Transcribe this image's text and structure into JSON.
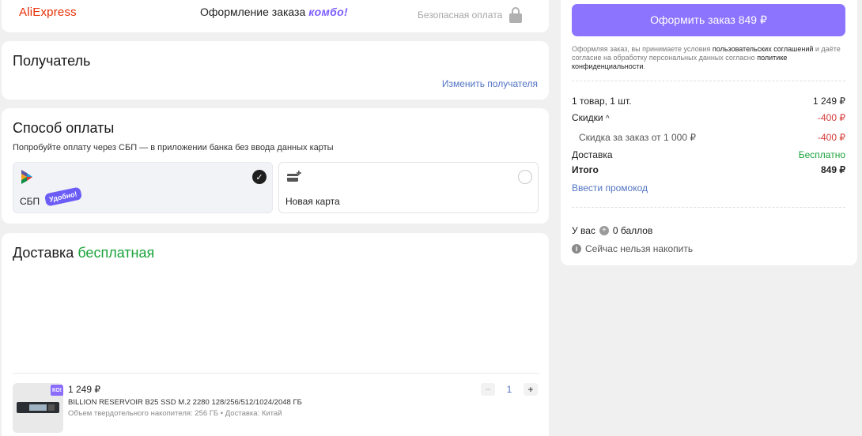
{
  "header": {
    "logo": "AliExpress",
    "title": "Оформление заказа",
    "combo": "комбо!",
    "secure": "Безопасная оплата"
  },
  "recipient": {
    "title": "Получатель",
    "change_link": "Изменить получателя"
  },
  "payment": {
    "title": "Способ оплаты",
    "hint": "Попробуйте оплату через СБП — в приложении банка без ввода данных карты",
    "options": [
      {
        "label": "СБП",
        "badge": "Удобно!",
        "selected": true
      },
      {
        "label": "Новая карта",
        "selected": false
      }
    ]
  },
  "delivery": {
    "title": "Доставка",
    "title_accent": "бесплатная",
    "product": {
      "price": "1 249 ₽",
      "name": "BILLION RESERVOIR B25 SSD M.2 2280 128/256/512/1024/2048 ГБ",
      "meta": "Объем твердотельного накопителя: 256 ГБ • Доставка: Китай",
      "quantity": "1",
      "minus": "−",
      "plus": "+",
      "combo_badge": "КО!"
    }
  },
  "summary": {
    "order_button": "Оформить заказ 849 ₽",
    "terms_prefix": "Оформляя заказ, вы принимаете условия ",
    "terms_link1": "пользовательских соглашений",
    "terms_middle": " и даёте согласие на обработку персональных данных согласно ",
    "terms_link2": "политике конфиденциальности",
    "terms_end": ".",
    "items_label": "1 товар, 1 шт.",
    "items_value": "1 249 ₽",
    "discounts_label": "Скидки",
    "discounts_value": "-400 ₽",
    "discount_detail_label": "Скидка за заказ от 1 000 ₽",
    "discount_detail_value": "-400 ₽",
    "delivery_label": "Доставка",
    "delivery_value": "Бесплатно",
    "total_label": "Итого",
    "total_value": "849 ₽",
    "promo_link": "Ввести промокод",
    "points_prefix": "У вас",
    "points_value": "0 баллов",
    "cannot_earn": "Сейчас нельзя накопить"
  },
  "colors": {
    "accent": "#8c74ff",
    "brand": "#e62e04",
    "link": "#5374c4",
    "negative": "#d63a3a",
    "positive": "#1aa33b"
  }
}
